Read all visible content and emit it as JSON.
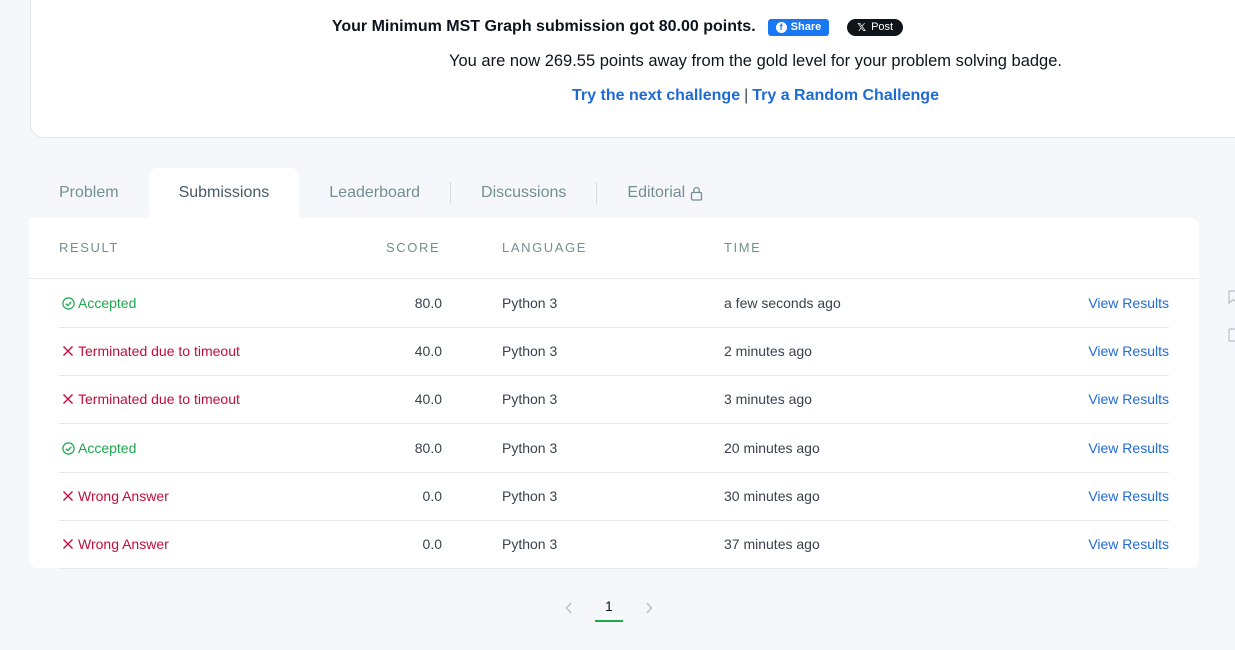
{
  "banner": {
    "headline": "Your Minimum MST Graph submission got 80.00 points.",
    "share_label": "Share",
    "post_label": "Post",
    "distance_text": "You are now 269.55 points away from the gold level for your problem solving badge.",
    "next_link": "Try the next challenge",
    "separator": "|",
    "random_link": "Try a Random Challenge"
  },
  "tabs": [
    {
      "label": "Problem",
      "active": false
    },
    {
      "label": "Submissions",
      "active": true
    },
    {
      "label": "Leaderboard",
      "active": false
    },
    {
      "label": "Discussions",
      "active": false
    },
    {
      "label": "Editorial",
      "active": false,
      "icon": "lock-icon"
    }
  ],
  "table": {
    "headers": {
      "result": "RESULT",
      "score": "SCORE",
      "language": "LANGUAGE",
      "time": "TIME"
    },
    "rows": [
      {
        "status": "Accepted",
        "ok": true,
        "score": "80.0",
        "language": "Python 3",
        "time": "a few seconds ago",
        "action": "View Results"
      },
      {
        "status": "Terminated due to timeout",
        "ok": false,
        "score": "40.0",
        "language": "Python 3",
        "time": "2 minutes ago",
        "action": "View Results"
      },
      {
        "status": "Terminated due to timeout",
        "ok": false,
        "score": "40.0",
        "language": "Python 3",
        "time": "3 minutes ago",
        "action": "View Results"
      },
      {
        "status": "Accepted",
        "ok": true,
        "score": "80.0",
        "language": "Python 3",
        "time": "20 minutes ago",
        "action": "View Results"
      },
      {
        "status": "Wrong Answer",
        "ok": false,
        "score": "0.0",
        "language": "Python 3",
        "time": "30 minutes ago",
        "action": "View Results"
      },
      {
        "status": "Wrong Answer",
        "ok": false,
        "score": "0.0",
        "language": "Python 3",
        "time": "37 minutes ago",
        "action": "View Results"
      }
    ]
  },
  "pagination": {
    "current_page": "1",
    "prev_icon": "chevron-left-icon",
    "next_icon": "chevron-right-icon"
  },
  "colors": {
    "accent": "#1ba94c",
    "error": "#c30d3a",
    "link": "#1f6bd6",
    "facebook": "#1877f2"
  }
}
